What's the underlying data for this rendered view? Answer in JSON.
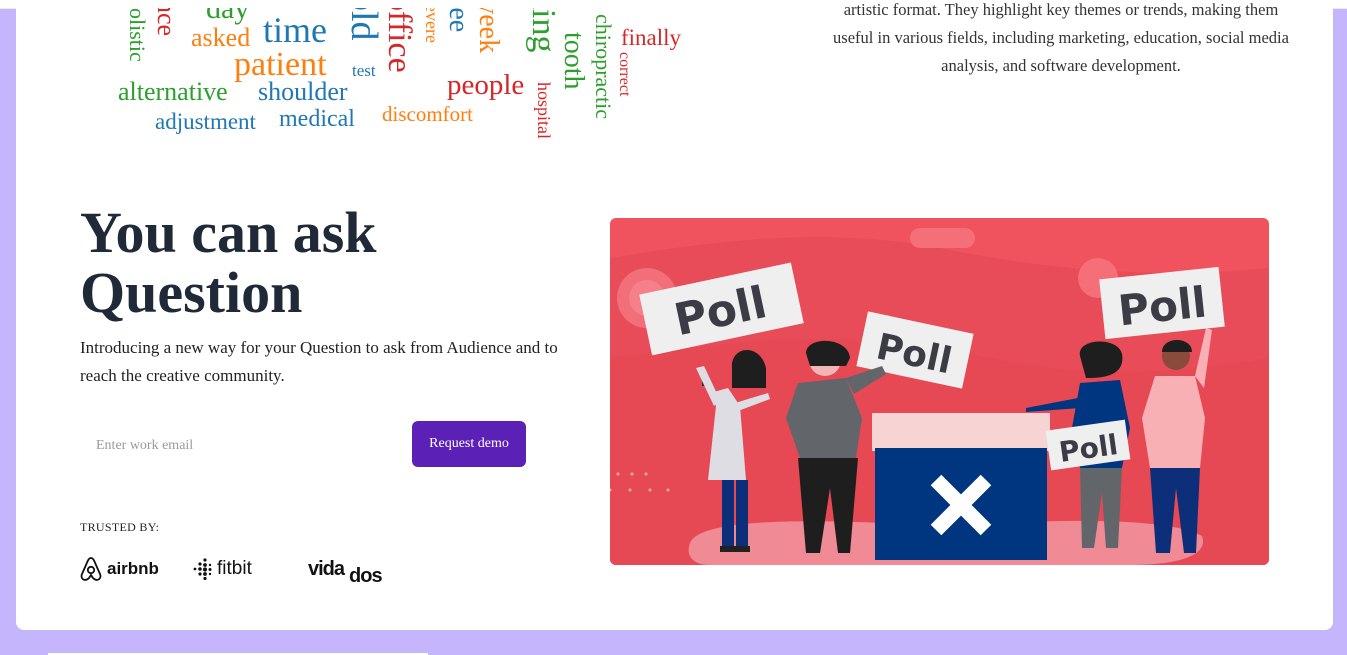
{
  "word_cloud": {
    "words": [
      {
        "text": "day",
        "color": "#2ca02c"
      },
      {
        "text": "time",
        "color": "#1f77b4"
      },
      {
        "text": "asked",
        "color": "#ff7f0e"
      },
      {
        "text": "patient",
        "color": "#ff7f0e"
      },
      {
        "text": "test",
        "color": "#1f77b4"
      },
      {
        "text": "alternative",
        "color": "#2ca02c"
      },
      {
        "text": "shoulder",
        "color": "#1f77b4"
      },
      {
        "text": "adjustment",
        "color": "#1f77b4"
      },
      {
        "text": "medical",
        "color": "#1f77b4"
      },
      {
        "text": "discomfort",
        "color": "#ff7f0e"
      },
      {
        "text": "people",
        "color": "#d62728"
      },
      {
        "text": "finally",
        "color": "#d62728"
      },
      {
        "text": "olistic",
        "color": "#2ca02c"
      },
      {
        "text": "nce",
        "color": "#d62728"
      },
      {
        "text": "old",
        "color": "#1f77b4"
      },
      {
        "text": "office",
        "color": "#d62728"
      },
      {
        "text": "evere",
        "color": "#ff7f0e"
      },
      {
        "text": "ree",
        "color": "#1f77b4"
      },
      {
        "text": "week",
        "color": "#ff7f0e"
      },
      {
        "text": "ning",
        "color": "#2ca02c"
      },
      {
        "text": "tooth",
        "color": "#2ca02c"
      },
      {
        "text": "hospital",
        "color": "#d62728"
      },
      {
        "text": "chiropractic",
        "color": "#2ca02c"
      },
      {
        "text": "correct",
        "color": "#d62728"
      }
    ],
    "description": "artistic format. They highlight key themes or trends, making them useful in various fields, including marketing, education, social media analysis, and software development."
  },
  "hero": {
    "title": "You can ask Question",
    "subtitle": "Introducing a new way for your Question to ask from Audience and to reach the creative community.",
    "email_placeholder": "Enter work email",
    "email_value": "",
    "cta_label": "Request demo",
    "trusted_label": "TRUSTED BY:"
  },
  "logos": {
    "airbnb": "airbnb",
    "fitbit": "fitbit",
    "vida": "vida",
    "dos": "dos"
  },
  "illustration": {
    "poll_signs": [
      "Poll",
      "Poll",
      "Poll",
      "Poll"
    ],
    "colors": {
      "background": "#f0525e",
      "ballot_box": "#003580",
      "sign": "#efefef",
      "accent": "#5b21b6"
    }
  }
}
